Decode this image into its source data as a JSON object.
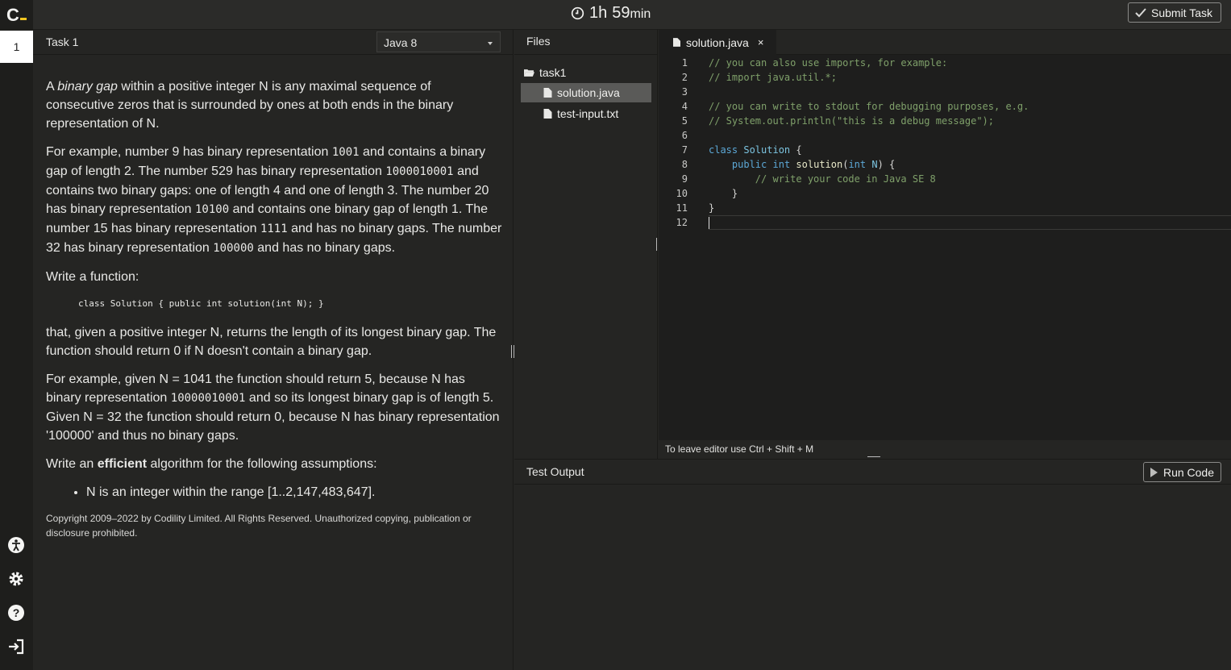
{
  "header": {
    "timer_hours": "1h",
    "timer_minutes": "59",
    "timer_min_unit": "min",
    "submit_label": "Submit Task"
  },
  "sidebar": {
    "task_number": "1",
    "icons": [
      "accessibility-icon",
      "gear-icon",
      "help-icon",
      "sign-out-icon"
    ]
  },
  "task": {
    "title": "Task 1",
    "language": "Java 8",
    "p1": {
      "pre": "A ",
      "em": "binary gap",
      "post": " within a positive integer N is any maximal sequence of consecutive zeros that is surrounded by ones at both ends in the binary representation of N."
    },
    "p2": {
      "t1": "For example, number 9 has binary representation ",
      "c1": "1001",
      "t2": " and contains a binary gap of length 2. The number 529 has binary representation ",
      "c2": "1000010001",
      "t3": " and contains two binary gaps: one of length 4 and one of length 3. The number 20 has binary representation ",
      "c3": "10100",
      "t4": " and contains one binary gap of length 1. The number 15 has binary representation ",
      "c4": "1111",
      "t5": " and has no binary gaps. The number 32 has binary representation ",
      "c5": "100000",
      "t6": " and has no binary gaps."
    },
    "p3": "Write a function:",
    "code_sig": "class Solution { public int solution(int N); }",
    "p4": "that, given a positive integer N, returns the length of its longest binary gap. The function should return 0 if N doesn't contain a binary gap.",
    "p5": {
      "t1": "For example, given N = 1041 the function should return 5, because N has binary representation ",
      "c1": "10000010001",
      "t2": " and so its longest binary gap is of length 5. Given N = 32 the function should return 0, because N has binary representation '100000' and thus no binary gaps."
    },
    "p6": {
      "t1": "Write an ",
      "strong": "efficient",
      "t2": " algorithm for the following assumptions:"
    },
    "assumption": "N is an integer within the range [1..2,147,483,647].",
    "copyright": "Copyright 2009–2022 by Codility Limited. All Rights Reserved. Unauthorized copying, publication or disclosure prohibited."
  },
  "files": {
    "title": "Files",
    "folder": "task1",
    "items": [
      "solution.java",
      "test-input.txt"
    ]
  },
  "editor": {
    "tab": "solution.java",
    "tab_close": "×",
    "line_numbers": [
      "1",
      "2",
      "3",
      "4",
      "5",
      "6",
      "7",
      "8",
      "9",
      "10",
      "11",
      "12"
    ],
    "code": {
      "l1": "// you can also use imports, for example:",
      "l2": "// import java.util.*;",
      "l4": "// you can write to stdout for debugging purposes, e.g.",
      "l5": "// System.out.println(\"this is a debug message\");",
      "l7_kw": "class",
      "l7_name": "Solution",
      "l7_rest": " {",
      "l8_kw1": "public",
      "l8_kw2": "int",
      "l8_fn": "solution",
      "l8_p1": "(",
      "l8_kw3": "int",
      "l8_arg": "N",
      "l8_rest": ") {",
      "l9": "// write your code in Java SE 8",
      "l10": "}",
      "l11": "}"
    },
    "hint": "To leave editor use Ctrl + Shift + M"
  },
  "output": {
    "title": "Test Output",
    "run_label": "Run Code"
  }
}
